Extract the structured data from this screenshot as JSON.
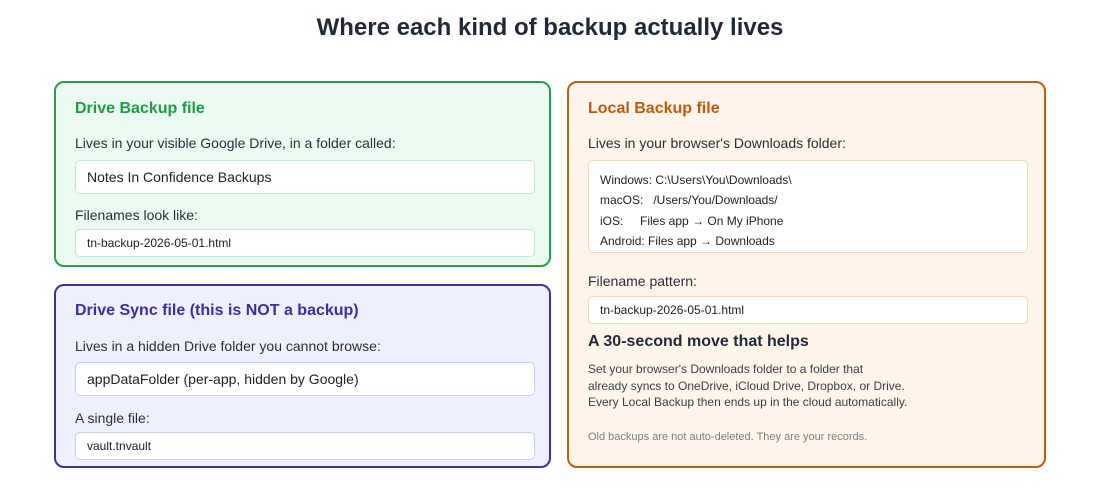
{
  "title": "Where each kind of backup actually lives",
  "drive_backup": {
    "heading": "Drive Backup file",
    "location_label": "Lives in your visible Google Drive, in a folder called:",
    "folder_name": "Notes In Confidence Backups",
    "filename_label": "Filenames look like:",
    "filename_example": "tn-backup-2026-05-01.html"
  },
  "drive_sync": {
    "heading": "Drive Sync file (this is NOT a backup)",
    "location_label": "Lives in a hidden Drive folder you cannot browse:",
    "folder_name": "appDataFolder (per-app, hidden by Google)",
    "filename_label": "A single file:",
    "filename_example": "vault.tnvault"
  },
  "local_backup": {
    "heading": "Local Backup file",
    "location_label": "Lives in your browser's Downloads folder:",
    "paths": [
      "Windows: C:\\Users\\You\\Downloads\\",
      "macOS:   /Users/You/Downloads/",
      "iOS:     Files app → On My iPhone",
      "Android: Files app → Downloads"
    ],
    "filename_label": "Filename pattern:",
    "filename_example": "tn-backup-2026-05-01.html",
    "tip_heading": "A 30-second move that helps",
    "tip_lines": [
      "Set your browser's Downloads folder to a folder that",
      "already syncs to OneDrive, iCloud Drive, Dropbox, or Drive.",
      "Every Local Backup then ends up in the cloud automatically."
    ],
    "footnote": "Old backups are not auto-deleted. They are your records."
  },
  "colors": {
    "drive_backup_accent": "#22a34a",
    "drive_sync_accent": "#3b31a6",
    "local_backup_accent": "#c05e12"
  }
}
